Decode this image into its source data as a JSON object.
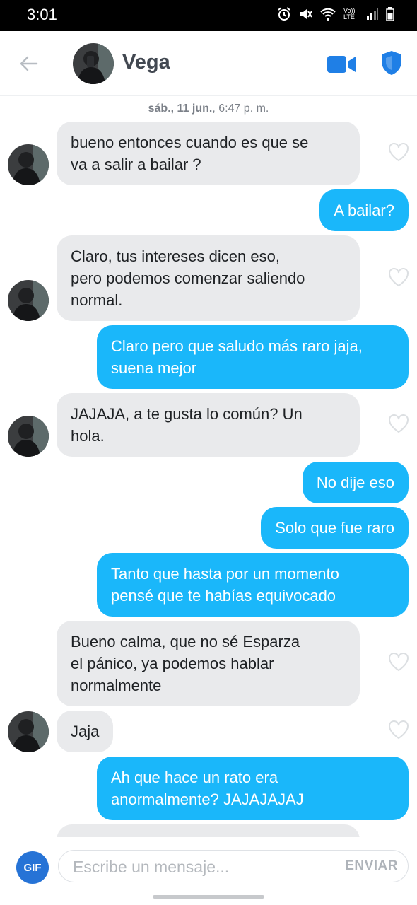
{
  "status_bar": {
    "time": "3:01",
    "network": "Vo)) LTE"
  },
  "header": {
    "contact_name": "Vega"
  },
  "date_label": {
    "day": "sáb., 11 jun.",
    "time": ", 6:47 p. m."
  },
  "messages": [
    {
      "from": "them",
      "text": "bueno entonces cuando es que se\nva a salir a bailar ?"
    },
    {
      "from": "me",
      "text": "A bailar?"
    },
    {
      "from": "them",
      "text": "Claro, tus intereses dicen eso,\npero podemos comenzar saliendo\nnormal."
    },
    {
      "from": "me",
      "text": "Claro pero que saludo más raro jaja,\nsuena mejor"
    },
    {
      "from": "them",
      "text": "JAJAJA, a te gusta lo común? Un\nhola."
    },
    {
      "from": "me",
      "text": "No dije eso"
    },
    {
      "from": "me",
      "text": "Solo que fue raro"
    },
    {
      "from": "me",
      "text": "Tanto que hasta por un momento\npensé que te habías equivocado"
    },
    {
      "from": "them",
      "text": "Bueno calma, que no sé Esparza\nel pánico, ya podemos hablar\nnormalmente"
    },
    {
      "from": "them",
      "text": "Jaja"
    },
    {
      "from": "me",
      "text": "Ah que hace un rato era\nanormalmente? JAJAJAJAJ"
    }
  ],
  "composer": {
    "gif_label": "GIF",
    "placeholder": "Escribe un mensaje...",
    "send_label": "ENVIAR"
  },
  "colors": {
    "sent_bubble": "#1ab7fa",
    "received_bubble": "#e9eaec",
    "accent_blue": "#2673d6",
    "header_icon_blue": "#1f7fe6"
  },
  "icons": [
    "back-arrow-icon",
    "video-camera-icon",
    "shield-icon",
    "heart-icon",
    "gif-icon"
  ]
}
